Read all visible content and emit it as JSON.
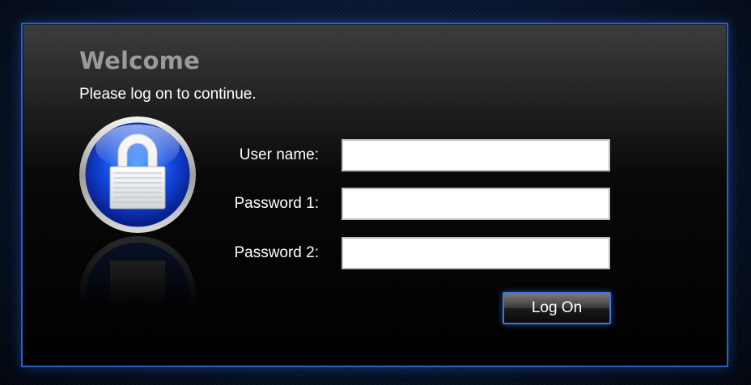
{
  "header": {
    "title": "Welcome",
    "subtitle": "Please log on to continue."
  },
  "form": {
    "username_label": "User name:",
    "username_value": "",
    "password1_label": "Password 1:",
    "password1_value": "",
    "password2_label": "Password 2:",
    "password2_value": "",
    "submit_label": "Log On"
  },
  "icons": {
    "lock": "lock-icon"
  },
  "colors": {
    "panel_border": "#2a5fc4",
    "title_gray": "#9a9a9a",
    "lock_blue": "#1e5cff"
  }
}
